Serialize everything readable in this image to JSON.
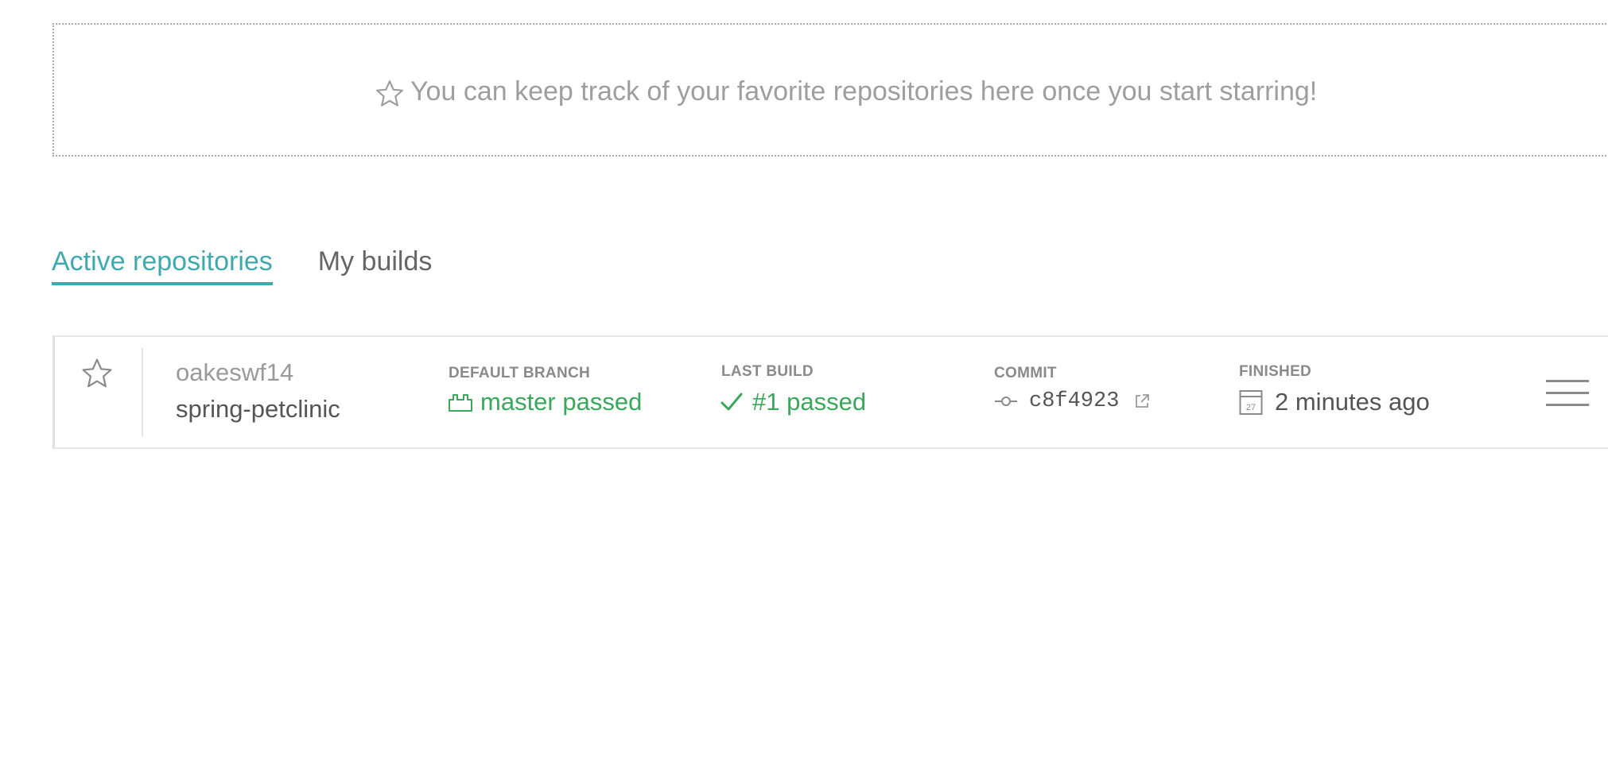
{
  "starred": {
    "message": "You can keep track of your favorite repositories here once you start starring!",
    "icon": "star-outline-icon"
  },
  "tabs": [
    {
      "label": "Active repositories",
      "active": true
    },
    {
      "label": "My builds",
      "active": false
    }
  ],
  "repo": {
    "owner": "oakeswf14",
    "name": "spring-petclinic",
    "default_branch": {
      "label": "DEFAULT BRANCH",
      "value": "master passed",
      "icon": "branch-icon"
    },
    "last_build": {
      "label": "LAST BUILD",
      "value": "#1 passed",
      "icon": "check-icon"
    },
    "commit": {
      "label": "COMMIT",
      "value": "c8f4923",
      "icon": "commit-icon",
      "link_icon": "external-link-icon"
    },
    "finished": {
      "label": "FINISHED",
      "value": "2 minutes ago",
      "calendar_day": "27",
      "icon": "calendar-icon"
    }
  },
  "colors": {
    "accent": "#3eaaaf",
    "passed": "#39a85b",
    "muted": "#9e9e9e"
  }
}
